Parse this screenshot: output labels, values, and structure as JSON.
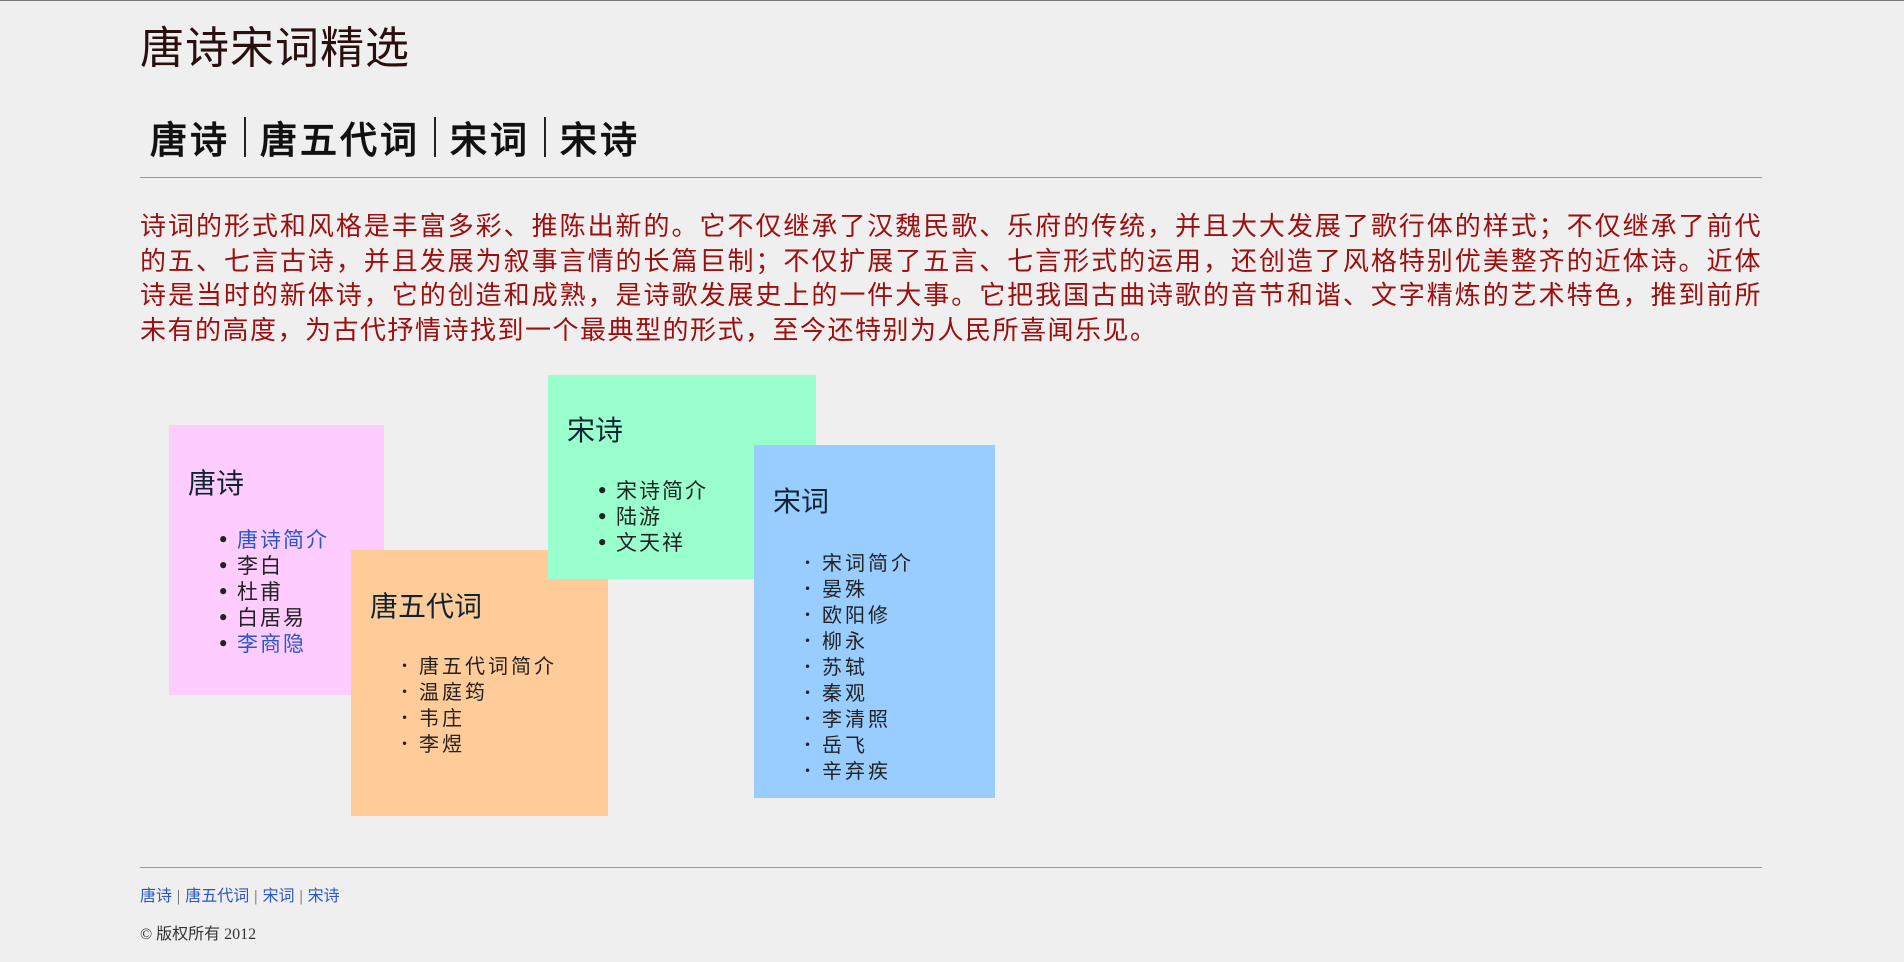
{
  "site": {
    "title": "唐诗宋词精选"
  },
  "brush_nav": [
    "唐诗",
    "唐五代词",
    "宋词",
    "宋诗"
  ],
  "intro": "诗词的形式和风格是丰富多彩、推陈出新的。它不仅继承了汉魏民歌、乐府的传统，并且大大发展了歌行体的样式；不仅继承了前代的五、七言古诗，并且发展为叙事言情的长篇巨制；不仅扩展了五言、七言形式的运用，还创造了风格特别优美整齐的近体诗。近体诗是当时的新体诗，它的创造和成熟，是诗歌发展史上的一件大事。它把我国古曲诗歌的音节和谐、文字精炼的艺术特色，推到前所未有的高度，为古代抒情诗找到一个最典型的形式，至今还特别为人民所喜闻乐见。",
  "cards": {
    "tang": {
      "title": "唐诗",
      "color": "#ffccff",
      "items": [
        "唐诗简介",
        "李白",
        "杜甫",
        "白居易",
        "李商隐"
      ]
    },
    "tang_wudai": {
      "title": "唐五代词",
      "color": "#ffcc99",
      "items": [
        "唐五代词简介",
        "温庭筠",
        "韦庄",
        "李煜"
      ]
    },
    "song_poem": {
      "title": "宋诗",
      "color": "#99ffcc",
      "items": [
        "宋诗简介",
        "陆游",
        "文天祥"
      ]
    },
    "song_ci": {
      "title": "宋词",
      "color": "#99ccff",
      "items": [
        "宋词简介",
        "晏殊",
        "欧阳修",
        "柳永",
        "苏轼",
        "秦观",
        "李清照",
        "岳飞",
        "辛弃疾"
      ]
    }
  },
  "footer": {
    "links": [
      "唐诗",
      "唐五代词",
      "宋词",
      "宋诗"
    ],
    "separator": "|",
    "copyright": "© 版权所有 2012"
  },
  "colors": {
    "background": "#efefef",
    "intro_text": "#9a0f0f",
    "link": "#2a57c4"
  }
}
